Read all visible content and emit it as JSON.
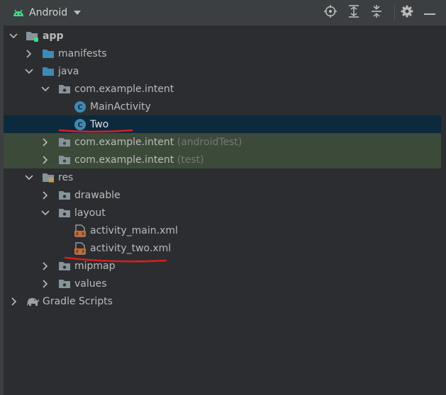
{
  "header": {
    "title": "Android"
  },
  "tree": {
    "app": "app",
    "manifests": "manifests",
    "java": "java",
    "pkg_main": "com.example.intent",
    "main_activity": "MainActivity",
    "two": "Two",
    "pkg_android_test": "com.example.intent",
    "android_test_hint": "(androidTest)",
    "pkg_test": "com.example.intent",
    "test_hint": "(test)",
    "res": "res",
    "drawable": "drawable",
    "layout": "layout",
    "activity_main": "activity_main.xml",
    "activity_two": "activity_two.xml",
    "mipmap": "mipmap",
    "values": "values",
    "gradle": "Gradle Scripts"
  },
  "icons": {
    "dropdown": "chevron-down-icon",
    "locate": "crosshair-icon",
    "expand_all": "expand-all-icon",
    "collapse_all": "collapse-all-icon",
    "settings": "gear-icon",
    "hide": "minimize-icon"
  },
  "colors": {
    "android_green": "#3ddc84",
    "selection": "#0d293e",
    "test_source_bg": "#3c4a3a",
    "class_icon": "#3d8ab5",
    "xml_icon": "#cc6a2b",
    "annotation_red": "#d8201c"
  }
}
